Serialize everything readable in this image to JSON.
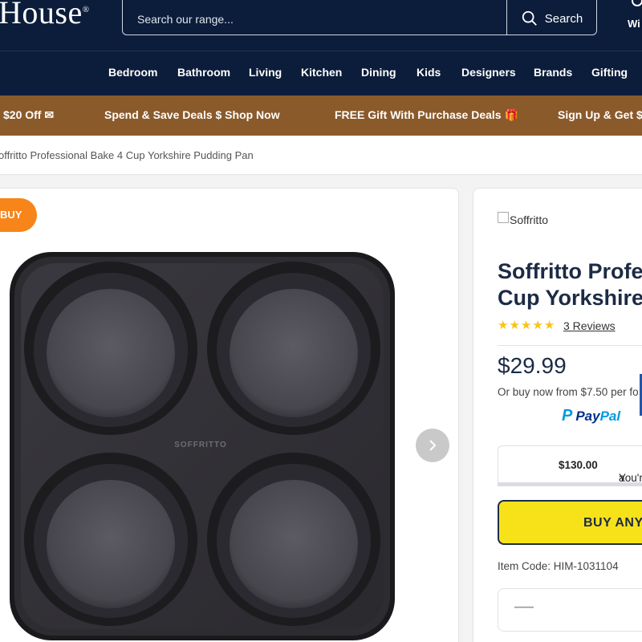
{
  "header": {
    "logo_text": "House",
    "logo_mark": "®",
    "search_placeholder": "Search our range...",
    "search_button_label": "Search",
    "wishlist_label": "Wi"
  },
  "nav": {
    "items": [
      "Bedroom",
      "Bathroom",
      "Living",
      "Kitchen",
      "Dining",
      "Kids",
      "Designers",
      "Brands",
      "Gifting"
    ]
  },
  "promo": {
    "items": [
      "$20 Off ✉",
      "Spend & Save Deals  $  Shop Now",
      "FREE Gift With Purchase Deals 🎁",
      "Sign Up & Get $"
    ]
  },
  "breadcrumb": {
    "current": "offritto Professional Bake 4 Cup Yorkshire Pudding Pan"
  },
  "gallery": {
    "badge": "BUY",
    "pan_brand_engraving": "SOFFRITTO"
  },
  "product": {
    "brand_alt": "Soffritto",
    "title_line1": "Soffritto Profes",
    "title_line2": "Cup Yorkshire",
    "rating_stars": 5,
    "reviews_label": "3 Reviews",
    "price": "$29.99",
    "installments": "Or buy now from $7.50 per fo",
    "paypal_label_pay": "Pay",
    "paypal_label_pal": "Pal",
    "savings_text_prefix": "You're ",
    "savings_amount": "$130.00",
    "savings_text_suffix": " a",
    "buy_button_label": "BUY ANY",
    "item_code": "Item Code: HIM-1031104",
    "qty_minus": "—"
  },
  "colors": {
    "header_bg": "#0b1d3a",
    "promo_bg": "#8b5a2b",
    "badge": "#f7851a",
    "buy_button": "#f7e21a",
    "stars": "#f5c518",
    "paypal_dark": "#003087",
    "paypal_light": "#009cde"
  }
}
